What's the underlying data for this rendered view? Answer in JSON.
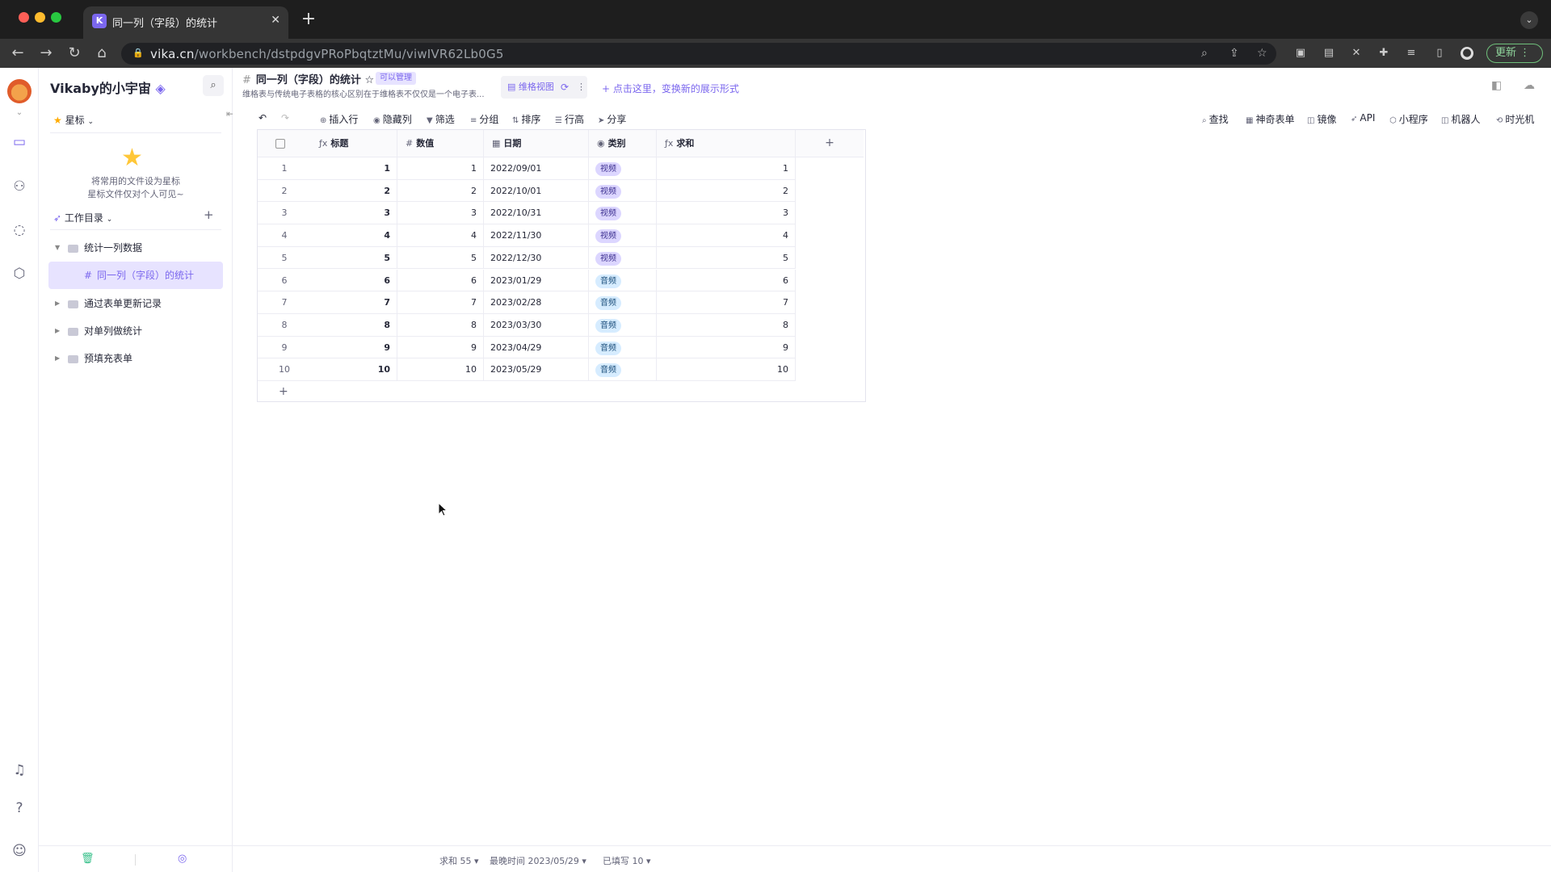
{
  "browser": {
    "tab_title": "同一列（字段）的统计",
    "tab_favicon_letter": "K",
    "url_host": "vika.cn",
    "url_path": "/workbench/dstpdgvPRoPbqtztMu/viwIVR62Lb0G5",
    "update_label": "更新",
    "icons": [
      "back-icon",
      "forward-icon",
      "reload-icon",
      "home-icon",
      "lock-icon",
      "zoom-icon",
      "share-icon",
      "star-icon",
      "extensions-icon",
      "profile-icon",
      "menu-icon"
    ]
  },
  "rail": {
    "icons": [
      "workbench-icon",
      "members-icon",
      "planet-icon",
      "settings-icon",
      "bell-icon",
      "help-icon",
      "user-icon"
    ]
  },
  "sidebar": {
    "space_name": "Vikaby的小宇宙",
    "star_header": "星标",
    "star_hint_line1": "将常用的文件设为星标",
    "star_hint_line2": "星标文件仅对个人可见~",
    "workdir_header": "工作目录",
    "tree": [
      {
        "label": "统计一列数据",
        "expanded": true
      },
      {
        "label": "同一列（字段）的统计",
        "active": true
      },
      {
        "label": "通过表单更新记录"
      },
      {
        "label": "对单列做统计"
      },
      {
        "label": "预填充表单"
      }
    ]
  },
  "datasheet": {
    "title": "同一列（字段）的统计",
    "permission": "可以管理",
    "description": "维格表与传统电子表格的核心区别在于维格表不仅仅是一个电子表...",
    "view_tab": "维格视图",
    "add_view": "+ 点击这里，变换新的展示形式"
  },
  "toolbar": {
    "left": [
      "插入行",
      "隐藏列",
      "筛选",
      "分组",
      "排序",
      "行高",
      "分享"
    ],
    "right": [
      "查找",
      "神奇表单",
      "镜像",
      "API",
      "小程序",
      "机器人",
      "时光机"
    ]
  },
  "grid": {
    "columns": [
      {
        "name": "标题",
        "type_icon": "fx"
      },
      {
        "name": "数值",
        "type_icon": "#"
      },
      {
        "name": "日期",
        "type_icon": "date"
      },
      {
        "name": "类别",
        "type_icon": "select"
      },
      {
        "name": "求和",
        "type_icon": "fx"
      }
    ],
    "rows": [
      {
        "idx": "1",
        "title": "1",
        "value": "1",
        "date": "2022/09/01",
        "category": "视频",
        "sum": "1"
      },
      {
        "idx": "2",
        "title": "2",
        "value": "2",
        "date": "2022/10/01",
        "category": "视频",
        "sum": "2"
      },
      {
        "idx": "3",
        "title": "3",
        "value": "3",
        "date": "2022/10/31",
        "category": "视频",
        "sum": "3"
      },
      {
        "idx": "4",
        "title": "4",
        "value": "4",
        "date": "2022/11/30",
        "category": "视频",
        "sum": "4"
      },
      {
        "idx": "5",
        "title": "5",
        "value": "5",
        "date": "2022/12/30",
        "category": "视频",
        "sum": "5"
      },
      {
        "idx": "6",
        "title": "6",
        "value": "6",
        "date": "2023/01/29",
        "category": "音频",
        "sum": "6"
      },
      {
        "idx": "7",
        "title": "7",
        "value": "7",
        "date": "2023/02/28",
        "category": "音频",
        "sum": "7"
      },
      {
        "idx": "8",
        "title": "8",
        "value": "8",
        "date": "2023/03/30",
        "category": "音频",
        "sum": "8"
      },
      {
        "idx": "9",
        "title": "9",
        "value": "9",
        "date": "2023/04/29",
        "category": "音频",
        "sum": "9"
      },
      {
        "idx": "10",
        "title": "10",
        "value": "10",
        "date": "2023/05/29",
        "category": "音频",
        "sum": "10"
      }
    ]
  },
  "statusbar": {
    "sum": "求和 55",
    "latest": "最晚时间 2023/05/29",
    "filled": "已填写 10"
  },
  "colors": {
    "accent": "#7b67ee",
    "pill_video": "#dcd6ff",
    "pill_audio": "#d6ecff"
  }
}
